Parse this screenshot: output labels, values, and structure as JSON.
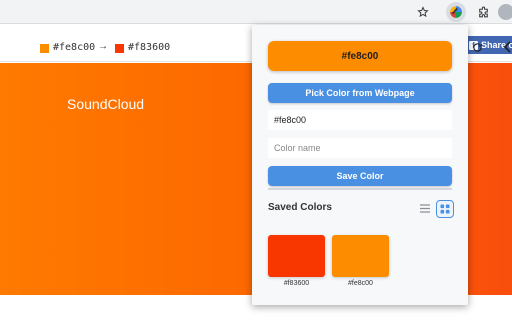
{
  "page": {
    "brand_text": "SoundCloud",
    "share_label": "Share o",
    "fb_letter": "f",
    "color_from": "#fe8c00",
    "color_to": "#f83600",
    "arrow": "→"
  },
  "popup": {
    "current_hex": "#fe8c00",
    "pick_button": "Pick Color from Webpage",
    "hex_input_value": "#fe8c00",
    "name_placeholder": "Color name",
    "save_button": "Save Color",
    "saved_title": "Saved Colors",
    "saved_colors": [
      {
        "hex": "#f83600",
        "label": "#f83600"
      },
      {
        "hex": "#fe8c00",
        "label": "#fe8c00"
      }
    ],
    "view_mode": "grid"
  },
  "colors": {
    "accent": "#4a90e2",
    "swatch_orange": "#fe8c00",
    "swatch_red": "#f83600"
  },
  "icons": {
    "toolbar": [
      "star-icon",
      "color-picker-extension-icon",
      "puzzle-icon",
      "profile-avatar"
    ],
    "page": [
      "facebook-icon",
      "refresh-icon",
      "chevron-left-icon"
    ],
    "popup": [
      "list-view-icon",
      "grid-view-icon"
    ]
  }
}
